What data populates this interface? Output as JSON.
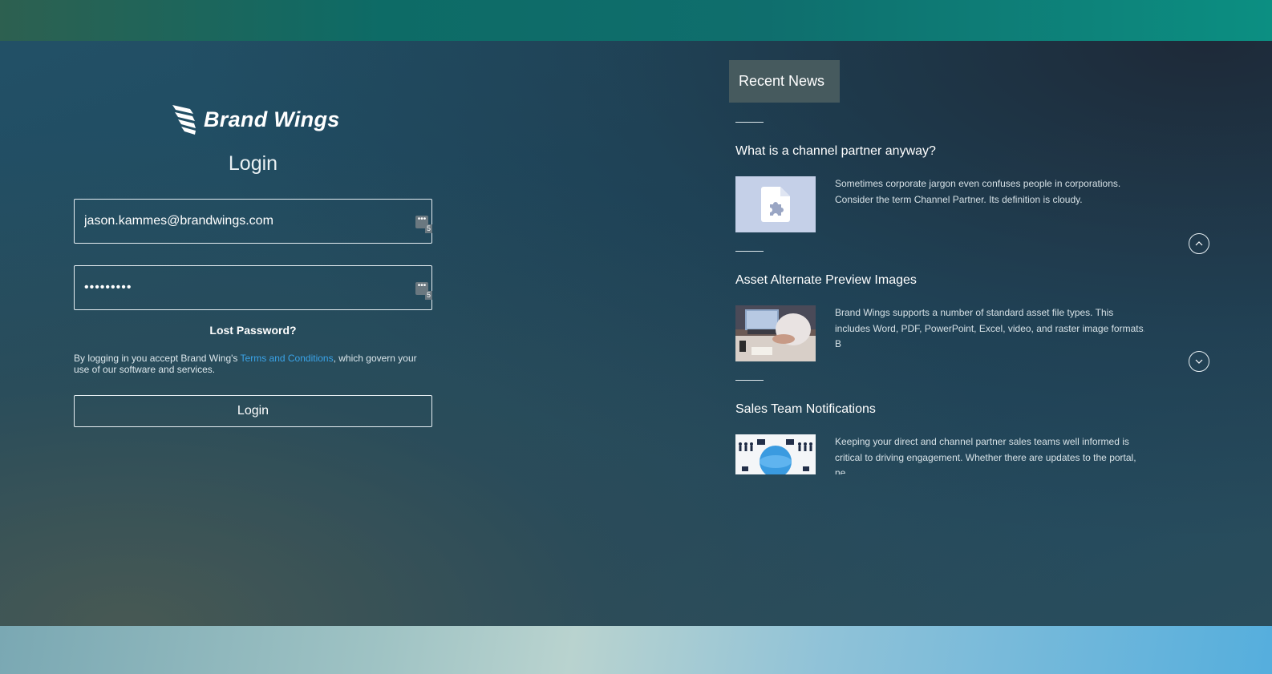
{
  "brand": {
    "name": "Brand Wings"
  },
  "login": {
    "title": "Login",
    "email_value": "jason.kammes@brandwings.com",
    "password_value": "•••••••••",
    "field_badge_count": "5",
    "lost_password": "Lost Password?",
    "terms_prefix": "By logging in you accept Brand Wing's ",
    "terms_link": "Terms and Conditions",
    "terms_suffix": ", which govern your use of our software and services.",
    "button_label": "Login"
  },
  "news": {
    "header": "Recent News",
    "items": [
      {
        "title": "What is a channel partner anyway?",
        "text": "Sometimes corporate jargon even confuses people in corporations. Consider the term Channel Partner. Its definition is cloudy."
      },
      {
        "title": "Asset Alternate Preview Images",
        "text": "Brand Wings supports a number of standard asset file types. This includes Word, PDF, PowerPoint, Excel, video, and raster image formats. B"
      },
      {
        "title": "Sales Team Notifications",
        "text": "Keeping your direct and channel partner sales teams well informed is critical to driving engagement. Whether there are updates to the portal, ne"
      }
    ]
  },
  "colors": {
    "link": "#3aa3e8",
    "news_header_bg": "#465a5e"
  }
}
